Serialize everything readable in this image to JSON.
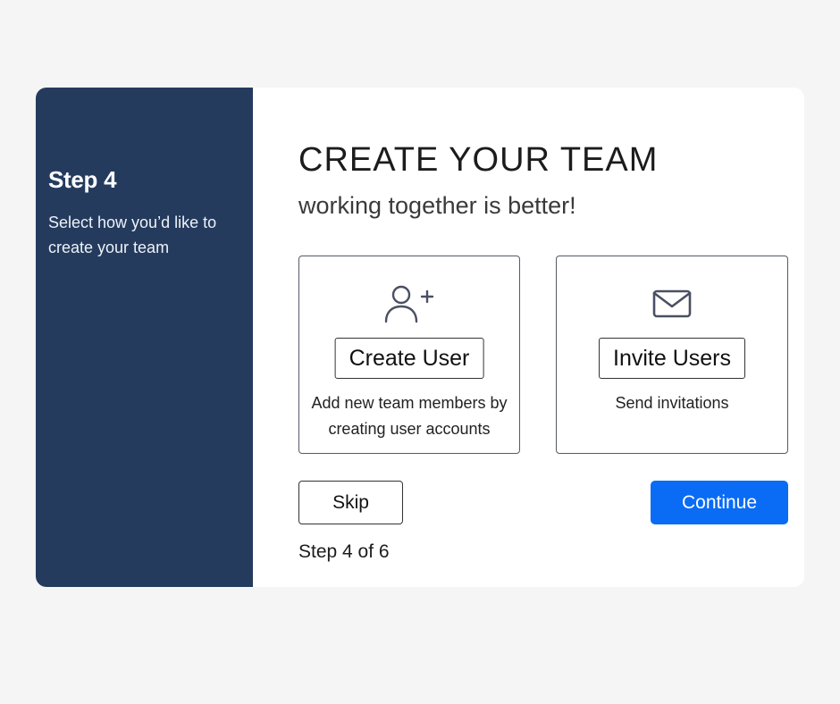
{
  "sidebar": {
    "title": "Step 4",
    "description": "Select how you’d like to create your team"
  },
  "main": {
    "title": "CREATE YOUR TEAM",
    "subtitle": "working together is better!",
    "options": [
      {
        "icon": "add-user-icon",
        "button_label": "Create User",
        "description": "Add new team members by creating user accounts"
      },
      {
        "icon": "mail-icon",
        "button_label": "Invite Users",
        "description": "Send invitations"
      }
    ],
    "skip_label": "Skip",
    "continue_label": "Continue",
    "step_indicator": "Step 4 of 6"
  },
  "colors": {
    "sidebar_bg": "#243b5e",
    "primary": "#0a6cf5",
    "page_bg": "#f5f5f5"
  }
}
